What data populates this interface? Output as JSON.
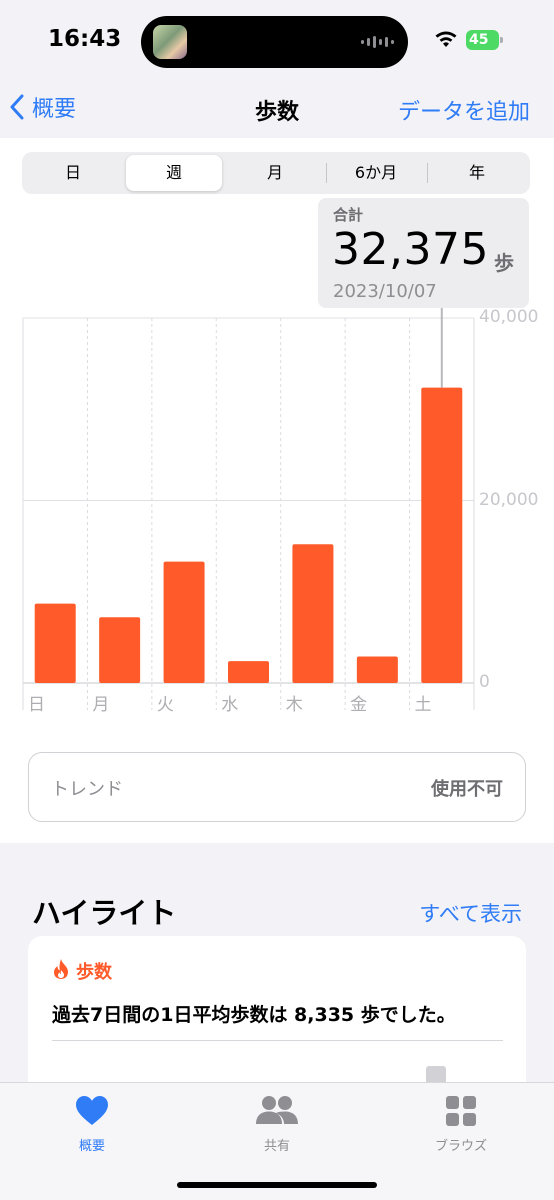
{
  "status": {
    "time": "16:43",
    "battery": "45"
  },
  "nav": {
    "back_label": "概要",
    "title": "歩数",
    "add_label": "データを追加"
  },
  "segments": [
    "日",
    "週",
    "月",
    "6か月",
    "年"
  ],
  "selected_segment": "週",
  "tooltip": {
    "label": "合計",
    "value": "32,375",
    "unit": "歩",
    "date": "2023/10/07"
  },
  "chart_data": {
    "type": "bar",
    "categories": [
      "日",
      "月",
      "火",
      "水",
      "木",
      "金",
      "土"
    ],
    "values": [
      8700,
      7200,
      13300,
      2400,
      15200,
      2900,
      32375
    ],
    "ylim": [
      0,
      40000
    ],
    "yticks": [
      "40,000",
      "20,000",
      "0"
    ],
    "bar_color": "#ff5a2a",
    "grid": true,
    "highlighted_category": "土"
  },
  "trend": {
    "label": "トレンド",
    "value": "使用不可"
  },
  "highlights": {
    "title": "ハイライト",
    "see_all": "すべて表示",
    "card": {
      "category": "歩数",
      "text": "過去7日間の1日平均歩数は 8,335 歩でした。"
    }
  },
  "tabbar": [
    {
      "label": "概要",
      "icon": "heart-icon",
      "active": true
    },
    {
      "label": "共有",
      "icon": "people-icon",
      "active": false
    },
    {
      "label": "ブラウズ",
      "icon": "grid-icon",
      "active": false
    }
  ],
  "colors": {
    "accent": "#2f7cf6",
    "steps": "#ff5a2a"
  }
}
